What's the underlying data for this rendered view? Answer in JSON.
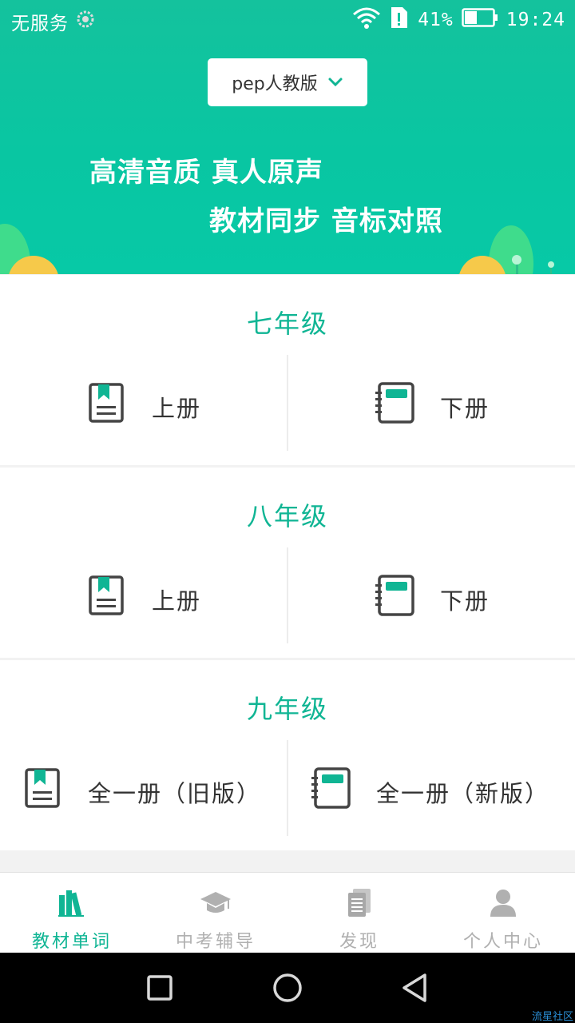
{
  "status_bar": {
    "carrier": "无服务",
    "battery_percent": "41%",
    "time": "19:24",
    "icons": [
      "settings-icon",
      "wifi-icon",
      "sim-alert-icon",
      "battery-icon"
    ]
  },
  "header": {
    "edition_label": "pep人教版",
    "banner_line1": "高清音质 真人原声",
    "banner_line2": "教材同步 音标对照",
    "colors": {
      "accent": "#0dc6a1",
      "hill_yellow": "#f5c542",
      "hill_green": "#3ddc84"
    }
  },
  "sections": [
    {
      "title": "七年级",
      "left": {
        "label": "上册",
        "icon": "bookmark-book-icon"
      },
      "right": {
        "label": "下册",
        "icon": "notebook-icon"
      }
    },
    {
      "title": "八年级",
      "left": {
        "label": "上册",
        "icon": "bookmark-book-icon"
      },
      "right": {
        "label": "下册",
        "icon": "notebook-icon"
      }
    },
    {
      "title": "九年级",
      "left": {
        "label": "全一册（旧版）",
        "icon": "bookmark-book-icon"
      },
      "right": {
        "label": "全一册（新版）",
        "icon": "notebook-icon"
      }
    }
  ],
  "tabs": [
    {
      "label": "教材单词",
      "icon": "books-icon",
      "active": true
    },
    {
      "label": "中考辅导",
      "icon": "graduation-cap-icon",
      "active": false
    },
    {
      "label": "发现",
      "icon": "documents-icon",
      "active": false
    },
    {
      "label": "个人中心",
      "icon": "person-icon",
      "active": false
    }
  ],
  "colors": {
    "tab_active": "#10b594",
    "tab_inactive": "#b0b0b0",
    "text": "#333333"
  },
  "watermark": "流星社区"
}
